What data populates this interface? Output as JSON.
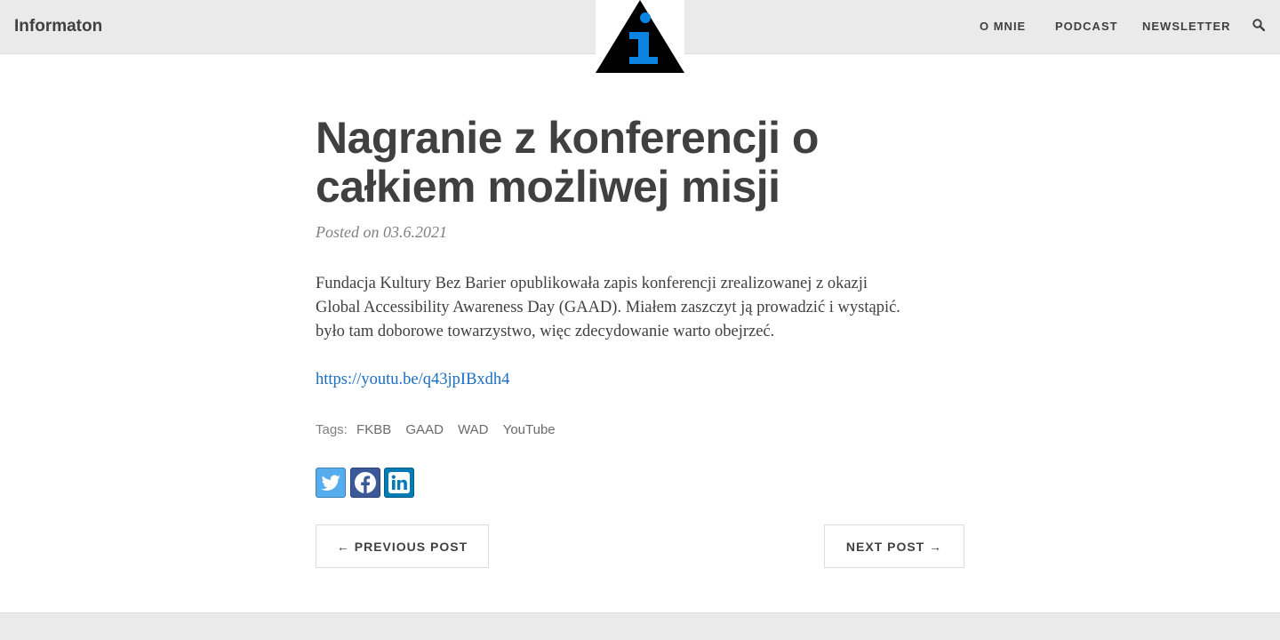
{
  "navbar": {
    "brand": "Informaton",
    "links": [
      "O MNIE",
      "PODCAST",
      "NEWSLETTER"
    ],
    "logo_icon": "info-triangle-icon",
    "search_icon": "search-icon"
  },
  "post": {
    "title": "Nagranie z konferencji o całkiem możliwej misji",
    "meta": "Posted on 03.6.2021",
    "body_lines": [
      "Fundacja Kultury Bez Barier opublikowała zapis konferencji zrealizowanej z okazji",
      "Global Accessibility Awareness Day (GAAD). Miałem zaszczyt ją prowadzić i wystąpić.",
      "było tam doborowe towarzystwo, więc zdecydowanie warto obejrzeć."
    ],
    "link": "https://youtu.be/q43jpIBxdh4"
  },
  "tags": {
    "label": "Tags:",
    "items": [
      "FKBB",
      "GAAD",
      "WAD",
      "YouTube"
    ]
  },
  "share": {
    "buttons": [
      {
        "icon": "twitter-icon",
        "color": "#55acee"
      },
      {
        "icon": "facebook-icon",
        "color": "#3b5998"
      },
      {
        "icon": "linkedin-icon",
        "color": "#007bb5"
      }
    ]
  },
  "pager": {
    "previous": "← PREVIOUS POST",
    "next": "NEXT POST →"
  },
  "colors": {
    "navbar_bg": "#eaeaea",
    "text": "#404040",
    "link": "#1a6fc4",
    "logo_accent": "#0a84e0"
  }
}
